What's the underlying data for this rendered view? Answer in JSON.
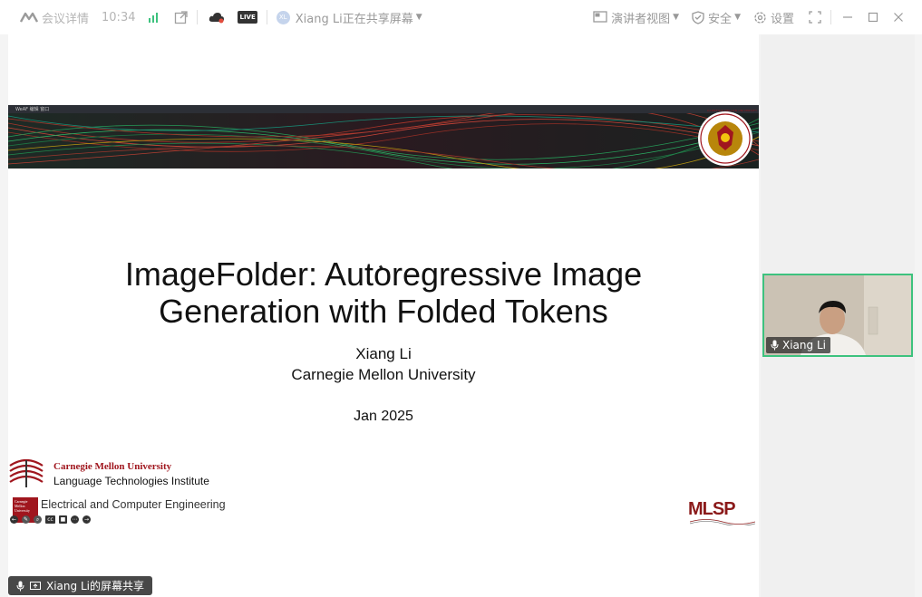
{
  "titlebar": {
    "meeting_details": "会议详情",
    "time": "10:34",
    "presenter_name": "Xiang Li正在共享屏幕",
    "avatar_initials": "XL",
    "live_badge": "LIVE",
    "presenter_view": "演讲者视图",
    "security": "安全",
    "settings": "设置"
  },
  "slide": {
    "title_line1": "ImageFolder: Autoregressive Image",
    "title_line2": "Generation with Folded Tokens",
    "author": "Xiang Li",
    "affiliation": "Carnegie Mellon University",
    "date": "Jan 2025",
    "lti_org": "Carnegie Mellon University",
    "lti_name": "Language Technologies Institute",
    "ece_name": "Electrical and Computer Engineering",
    "ece_logo_text": "Carnegie Mellon University",
    "mlsp_logo": "MLSP",
    "banner_topbar": "WeAF  编辑  窗口",
    "seal_text": "CARNEGIE MELLON UNIVERSITY"
  },
  "participant": {
    "name": "Xiang Li"
  },
  "share_badge": {
    "label": "Xiang Li的屏幕共享"
  },
  "colors": {
    "active_speaker_border": "#3dc27e",
    "cmu_red": "#a0161e"
  }
}
